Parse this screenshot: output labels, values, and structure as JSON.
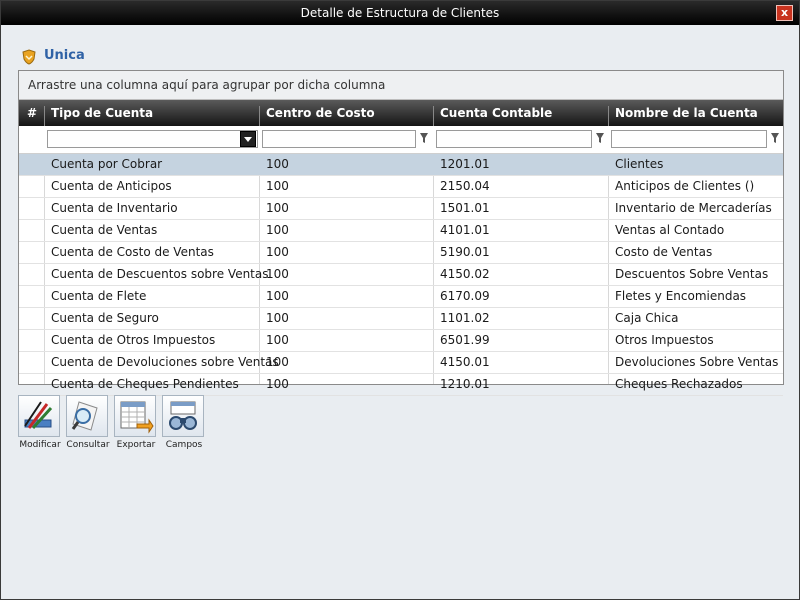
{
  "window": {
    "title": "Detalle de Estructura de Clientes",
    "close_label": "x"
  },
  "section": {
    "label": "Unica"
  },
  "grid": {
    "group_hint": "Arrastre una columna aquí para agrupar por dicha columna",
    "columns": [
      "#",
      "Tipo de Cuenta",
      "Centro de Costo",
      "Cuenta Contable",
      "Nombre de la Cuenta"
    ],
    "rows": [
      {
        "tipo": "Cuenta por Cobrar",
        "centro": "100",
        "cuenta": "1201.01",
        "nombre": "Clientes"
      },
      {
        "tipo": "Cuenta de Anticipos",
        "centro": "100",
        "cuenta": "2150.04",
        "nombre": "Anticipos de Clientes ()"
      },
      {
        "tipo": "Cuenta de Inventario",
        "centro": "100",
        "cuenta": "1501.01",
        "nombre": "Inventario de Mercaderías"
      },
      {
        "tipo": "Cuenta de Ventas",
        "centro": "100",
        "cuenta": "4101.01",
        "nombre": "Ventas al Contado"
      },
      {
        "tipo": "Cuenta de Costo de Ventas",
        "centro": "100",
        "cuenta": "5190.01",
        "nombre": "Costo de Ventas"
      },
      {
        "tipo": "Cuenta de Descuentos sobre Ventas",
        "centro": "100",
        "cuenta": "4150.02",
        "nombre": "Descuentos Sobre Ventas"
      },
      {
        "tipo": "Cuenta de Flete",
        "centro": "100",
        "cuenta": "6170.09",
        "nombre": "Fletes y Encomiendas"
      },
      {
        "tipo": "Cuenta de Seguro",
        "centro": "100",
        "cuenta": "1101.02",
        "nombre": "Caja Chica"
      },
      {
        "tipo": "Cuenta de Otros Impuestos",
        "centro": "100",
        "cuenta": "6501.99",
        "nombre": "Otros Impuestos"
      },
      {
        "tipo": "Cuenta de Devoluciones sobre Ventas",
        "centro": "100",
        "cuenta": "4150.01",
        "nombre": "Devoluciones Sobre Ventas"
      },
      {
        "tipo": "Cuenta de Cheques Pendientes",
        "centro": "100",
        "cuenta": "1210.01",
        "nombre": "Cheques Rechazados"
      }
    ]
  },
  "toolbar": {
    "modificar": "Modificar",
    "consultar": "Consultar",
    "exportar": "Exportar",
    "campos": "Campos"
  },
  "colors": {
    "accent": "#2f62a6",
    "selected_row": "#c5d3e0",
    "header_dark": "#151515"
  }
}
